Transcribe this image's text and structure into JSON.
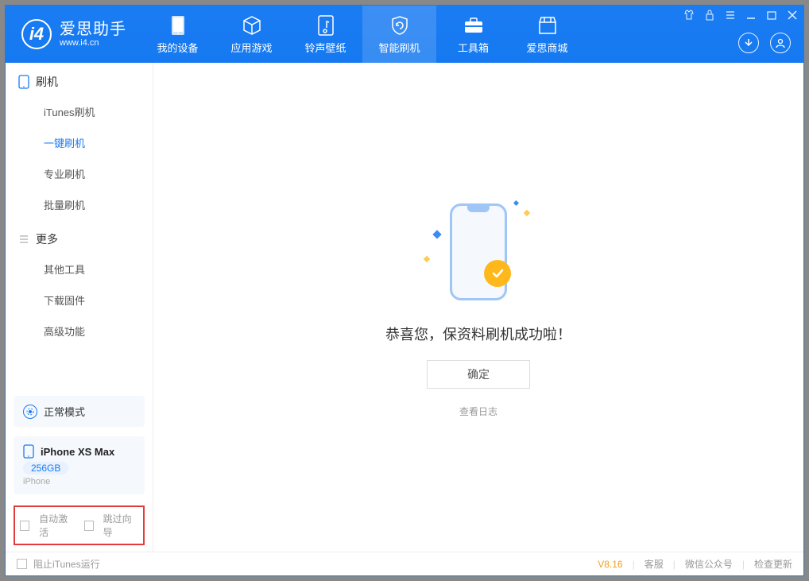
{
  "app": {
    "name_cn": "爱思助手",
    "url": "www.i4.cn"
  },
  "nav": {
    "tabs": [
      {
        "label": "我的设备"
      },
      {
        "label": "应用游戏"
      },
      {
        "label": "铃声壁纸"
      },
      {
        "label": "智能刷机"
      },
      {
        "label": "工具箱"
      },
      {
        "label": "爱思商城"
      }
    ]
  },
  "sidebar": {
    "section1": {
      "title": "刷机",
      "items": [
        "iTunes刷机",
        "一键刷机",
        "专业刷机",
        "批量刷机"
      ]
    },
    "section2": {
      "title": "更多",
      "items": [
        "其他工具",
        "下载固件",
        "高级功能"
      ]
    },
    "mode_label": "正常模式",
    "device": {
      "name": "iPhone XS Max",
      "capacity": "256GB",
      "type": "iPhone"
    },
    "checkboxes": {
      "auto_activate": "自动激活",
      "skip_guide": "跳过向导"
    }
  },
  "content": {
    "success_message": "恭喜您，保资料刷机成功啦！",
    "confirm_button": "确定",
    "view_log": "查看日志"
  },
  "footer": {
    "block_itunes": "阻止iTunes运行",
    "version": "V8.16",
    "links": [
      "客服",
      "微信公众号",
      "检查更新"
    ]
  }
}
